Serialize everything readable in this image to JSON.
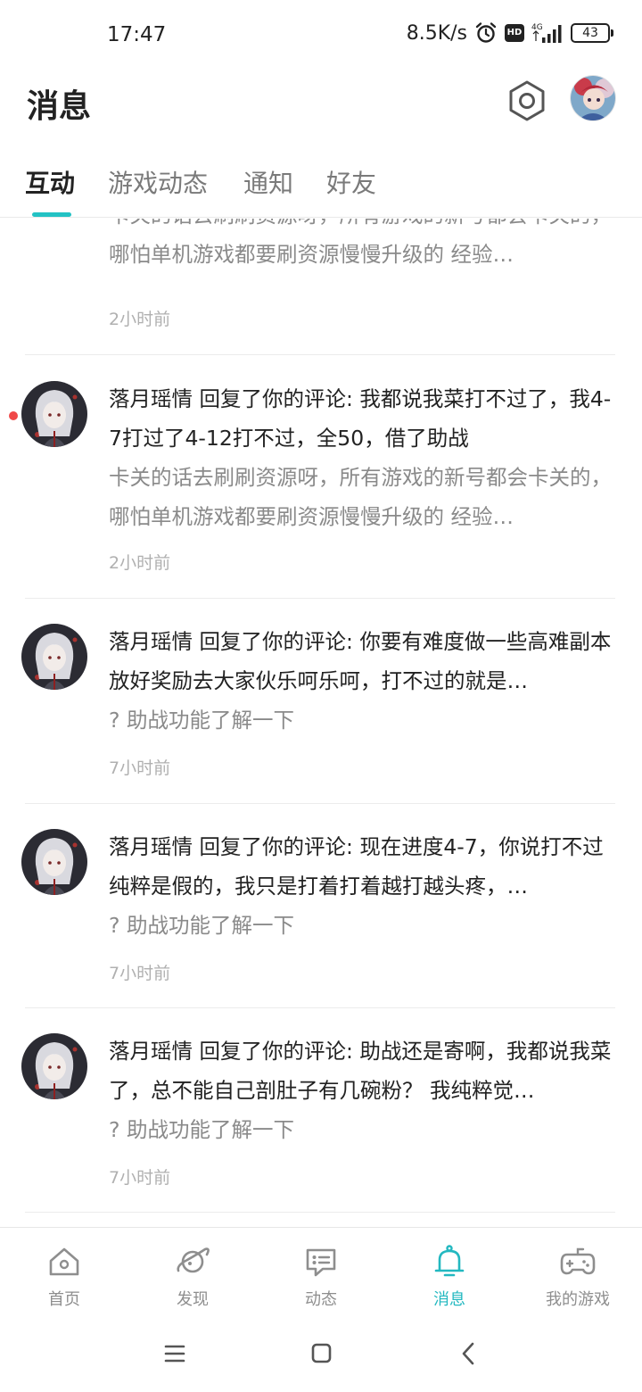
{
  "status_bar": {
    "time": "17:47",
    "net_speed": "8.5K/s",
    "network": "4G",
    "hd_badge": "HD",
    "battery": "43",
    "icons": [
      "alarm-icon",
      "hd-icon",
      "signal-icon",
      "battery-icon"
    ]
  },
  "header": {
    "title": "消息",
    "settings_icon": "settings-hexagon-icon"
  },
  "tabs": [
    {
      "label": "互动",
      "active": true
    },
    {
      "label": "游戏动态",
      "active": false
    },
    {
      "label": "通知",
      "active": false
    },
    {
      "label": "好友",
      "active": false
    }
  ],
  "messages": [
    {
      "title": "",
      "quote": "卡关的话去刷刷资源呀，所有游戏的新号都会卡关的，哪怕单机游戏都要刷资源慢慢升级的 经验…",
      "time": "2小时前",
      "unread": false,
      "partial": true
    },
    {
      "title": "落月瑶情 回复了你的评论: 我都说我菜打不过了，我4-7打过了4-12打不过，全50，借了助战",
      "quote": "卡关的话去刷刷资源呀，所有游戏的新号都会卡关的，哪怕单机游戏都要刷资源慢慢升级的 经验…",
      "time": "2小时前",
      "unread": true
    },
    {
      "title": "落月瑶情 回复了你的评论: 你要有难度做一些高难副本放好奖励去大家伙乐呵乐呵，打不过的就是…",
      "quote": "? 助战功能了解一下",
      "time": "7小时前",
      "unread": false
    },
    {
      "title": "落月瑶情 回复了你的评论: 现在进度4-7，你说打不过纯粹是假的，我只是打着打着越打越头疼，…",
      "quote": "? 助战功能了解一下",
      "time": "7小时前",
      "unread": false
    },
    {
      "title": "落月瑶情 回复了你的评论: 助战还是寄啊，我都说我菜了，总不能自己剖肚子有几碗粉？ 我纯粹觉…",
      "quote": "? 助战功能了解一下",
      "time": "7小时前",
      "unread": false
    }
  ],
  "bottom_nav": [
    {
      "label": "首页",
      "icon": "home-icon",
      "active": false
    },
    {
      "label": "发现",
      "icon": "planet-icon",
      "active": false
    },
    {
      "label": "动态",
      "icon": "feed-chat-icon",
      "active": false
    },
    {
      "label": "消息",
      "icon": "bell-icon",
      "active": true
    },
    {
      "label": "我的游戏",
      "icon": "gamepad-icon",
      "active": false
    }
  ],
  "system_nav": [
    "menu-icon",
    "home-square-icon",
    "back-icon"
  ],
  "colors": {
    "accent": "#23c2c4",
    "unread_dot": "#f04848",
    "text_primary": "#222222",
    "text_secondary": "#8a8a8a",
    "text_time": "#b0b0b0"
  }
}
